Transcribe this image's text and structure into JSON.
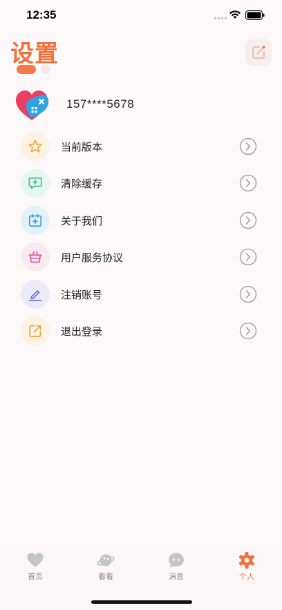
{
  "status": {
    "time": "12:35"
  },
  "header": {
    "title": "设置"
  },
  "profile": {
    "phone": "157****5678"
  },
  "menu": {
    "items": [
      {
        "label": "当前版本",
        "icon": "star-icon",
        "color": "#f5a53a",
        "bg": "#fdf3e2"
      },
      {
        "label": "清除缓存",
        "icon": "chat-plus-icon",
        "color": "#2fbf8a",
        "bg": "#e6f7ef"
      },
      {
        "label": "关于我们",
        "icon": "calendar-plus-icon",
        "color": "#2da3d6",
        "bg": "#e3f2f8"
      },
      {
        "label": "用户服务协议",
        "icon": "basket-icon",
        "color": "#e3559e",
        "bg": "#f8ebef"
      },
      {
        "label": "注销账号",
        "icon": "pencil-icon",
        "color": "#6a63d4",
        "bg": "#ebebf8"
      },
      {
        "label": "退出登录",
        "icon": "share-out-icon",
        "color": "#f0a030",
        "bg": "#fdf3e2"
      }
    ]
  },
  "tabs": [
    {
      "label": "首页",
      "icon": "heart-icon",
      "active": false
    },
    {
      "label": "看看",
      "icon": "planet-icon",
      "active": false
    },
    {
      "label": "消息",
      "icon": "message-icon",
      "active": false
    },
    {
      "label": "个人",
      "icon": "gear-icon",
      "active": true
    }
  ],
  "colors": {
    "accent": "#f2703a",
    "inactive_tab": "#c4c4c4",
    "arrow": "#999999"
  }
}
